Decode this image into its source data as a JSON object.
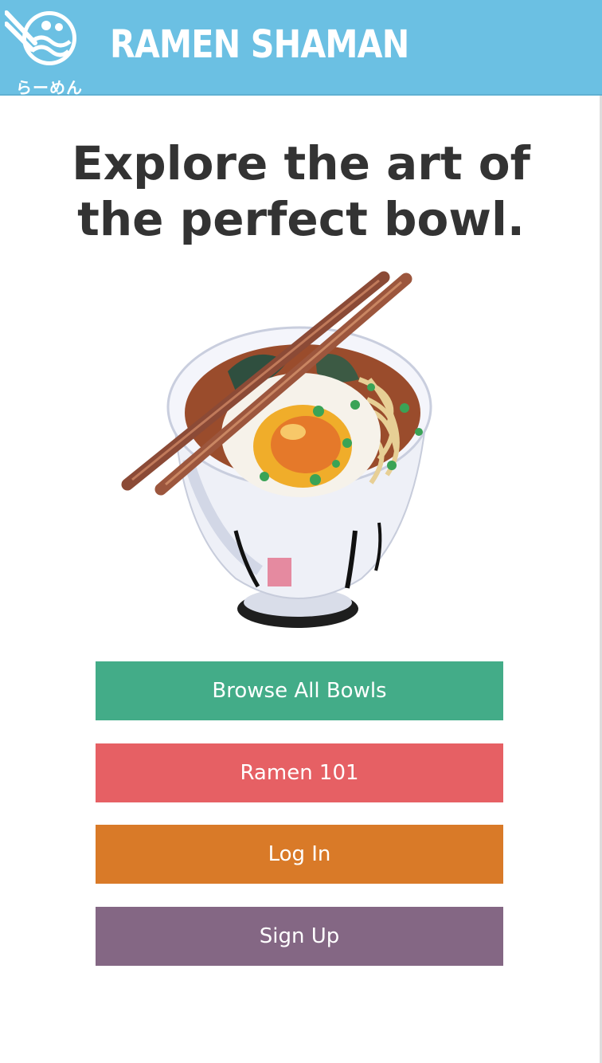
{
  "header": {
    "brand": "RAMEN SHAMAN",
    "logo_kana": "らーめん",
    "logo_icon": "ramen-bowl-chopsticks-icon",
    "background_color": "#6bc0e3"
  },
  "hero": {
    "headline_line1": "Explore the art of",
    "headline_line2": "the perfect bowl.",
    "image_subject": "watercolor ramen bowl with egg, noodles, green onion and chopsticks"
  },
  "actions": {
    "browse": {
      "label": "Browse All Bowls",
      "color": "#43ac88"
    },
    "ramen101": {
      "label": "Ramen 101",
      "color": "#e66064"
    },
    "login": {
      "label": "Log In",
      "color": "#d97a28"
    },
    "signup": {
      "label": "Sign Up",
      "color": "#846784"
    }
  }
}
